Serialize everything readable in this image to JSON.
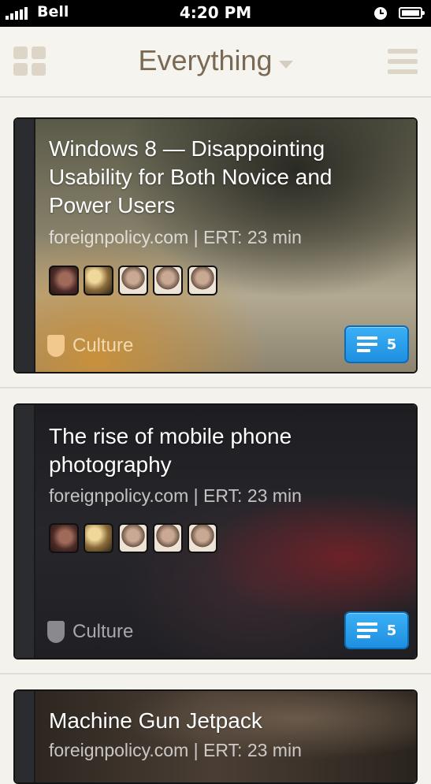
{
  "status_bar": {
    "carrier": "Bell",
    "time": "4:20 PM"
  },
  "nav": {
    "title": "Everything"
  },
  "colors": {
    "accent_blue": "#1f8fe0",
    "background": "#f4f2ec",
    "title_brown": "#7a6a55"
  },
  "cards": [
    {
      "title": "Windows 8 — Disappointing Usability for Both Novice and Power Users",
      "source": "foreignpolicy.com | ERT: 23 min",
      "category": "Culture",
      "comment_count": "5"
    },
    {
      "title": "The rise of mobile phone photography",
      "source": "foreignpolicy.com | ERT: 23 min",
      "category": "Culture",
      "comment_count": "5"
    },
    {
      "title": "Machine Gun Jetpack",
      "source": "foreignpolicy.com | ERT: 23 min"
    }
  ]
}
